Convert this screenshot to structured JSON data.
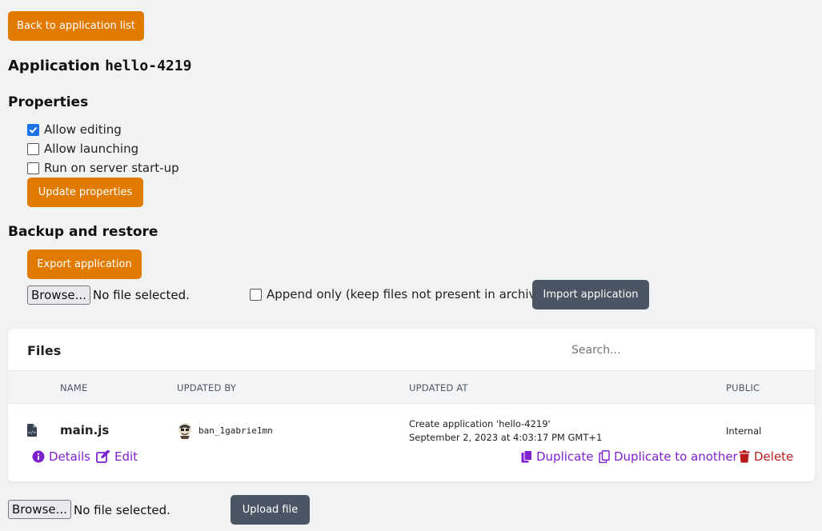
{
  "header": {
    "back_label": "Back to application list",
    "title_prefix": "Application ",
    "app_name": "hello-4219"
  },
  "properties": {
    "heading": "Properties",
    "options": [
      {
        "label": "Allow editing",
        "checked": true
      },
      {
        "label": "Allow launching",
        "checked": false
      },
      {
        "label": "Run on server start-up",
        "checked": false
      }
    ],
    "update_label": "Update properties"
  },
  "backup": {
    "heading": "Backup and restore",
    "export_label": "Export application",
    "browse_label": "Browse...",
    "no_file": "No file selected.",
    "append_label": "Append only (keep files not present in archive)",
    "append_checked": false,
    "import_label": "Import application"
  },
  "files": {
    "heading": "Files",
    "search_placeholder": "Search...",
    "columns": [
      "NAME",
      "UPDATED BY",
      "UPDATED AT",
      "PUBLIC"
    ],
    "rows": [
      {
        "name": "main.js",
        "updated_by": "ban_1gabrie1mn",
        "updated_msg": "Create application 'hello-4219'",
        "updated_at": "September 2, 2023 at 4:03:17 PM GMT+1",
        "public": "Internal",
        "actions": {
          "details": "Details",
          "edit": "Edit",
          "duplicate": "Duplicate",
          "duplicate_another": "Duplicate to another",
          "delete": "Delete"
        }
      }
    ]
  },
  "upload": {
    "browse_label": "Browse...",
    "no_file": "No file selected.",
    "upload_label": "Upload file"
  },
  "colors": {
    "accent": "#e07b00",
    "dark_button": "#4b5563",
    "link": "#7e22ce",
    "danger": "#b91c1c"
  }
}
